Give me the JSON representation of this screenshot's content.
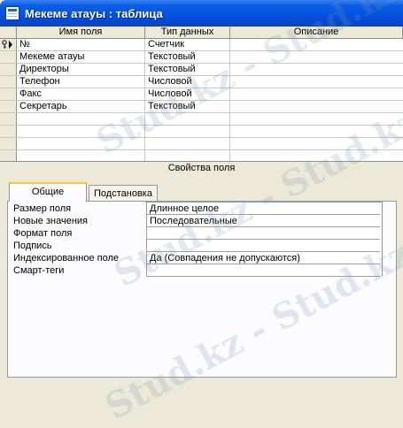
{
  "window": {
    "title": "Мекеме атауы : таблица"
  },
  "grid": {
    "columns": [
      "Имя поля",
      "Тип данных",
      "Описание"
    ],
    "rows": [
      {
        "name": "№",
        "type": "Счетчик",
        "desc": "",
        "key": true
      },
      {
        "name": "Мекеме атауы",
        "type": "Текстовый",
        "desc": ""
      },
      {
        "name": "Директоры",
        "type": "Текстовый",
        "desc": ""
      },
      {
        "name": "Телефон",
        "type": "Числовой",
        "desc": ""
      },
      {
        "name": "Факс",
        "type": "Числовой",
        "desc": ""
      },
      {
        "name": "Секретарь",
        "type": "Текстовый",
        "desc": ""
      },
      {
        "name": "",
        "type": "",
        "desc": ""
      },
      {
        "name": "",
        "type": "",
        "desc": ""
      },
      {
        "name": "",
        "type": "",
        "desc": ""
      },
      {
        "name": "",
        "type": "",
        "desc": ""
      }
    ]
  },
  "properties": {
    "section_title": "Свойства поля",
    "tabs": [
      "Общие",
      "Подстановка"
    ],
    "items": [
      {
        "label": "Размер поля",
        "value": "Длинное целое"
      },
      {
        "label": "Новые значения",
        "value": "Последовательные"
      },
      {
        "label": "Формат поля",
        "value": ""
      },
      {
        "label": "Подпись",
        "value": ""
      },
      {
        "label": "Индексированное поле",
        "value": "Да (Совпадения не допускаются)"
      },
      {
        "label": "Смарт-теги",
        "value": ""
      }
    ]
  },
  "watermark": "Stud.kz - Stud.kz",
  "colors": {
    "title_bar": "#0550DC",
    "panel_bg": "#ECE9D8",
    "tab_accent": "#FFC83C"
  }
}
